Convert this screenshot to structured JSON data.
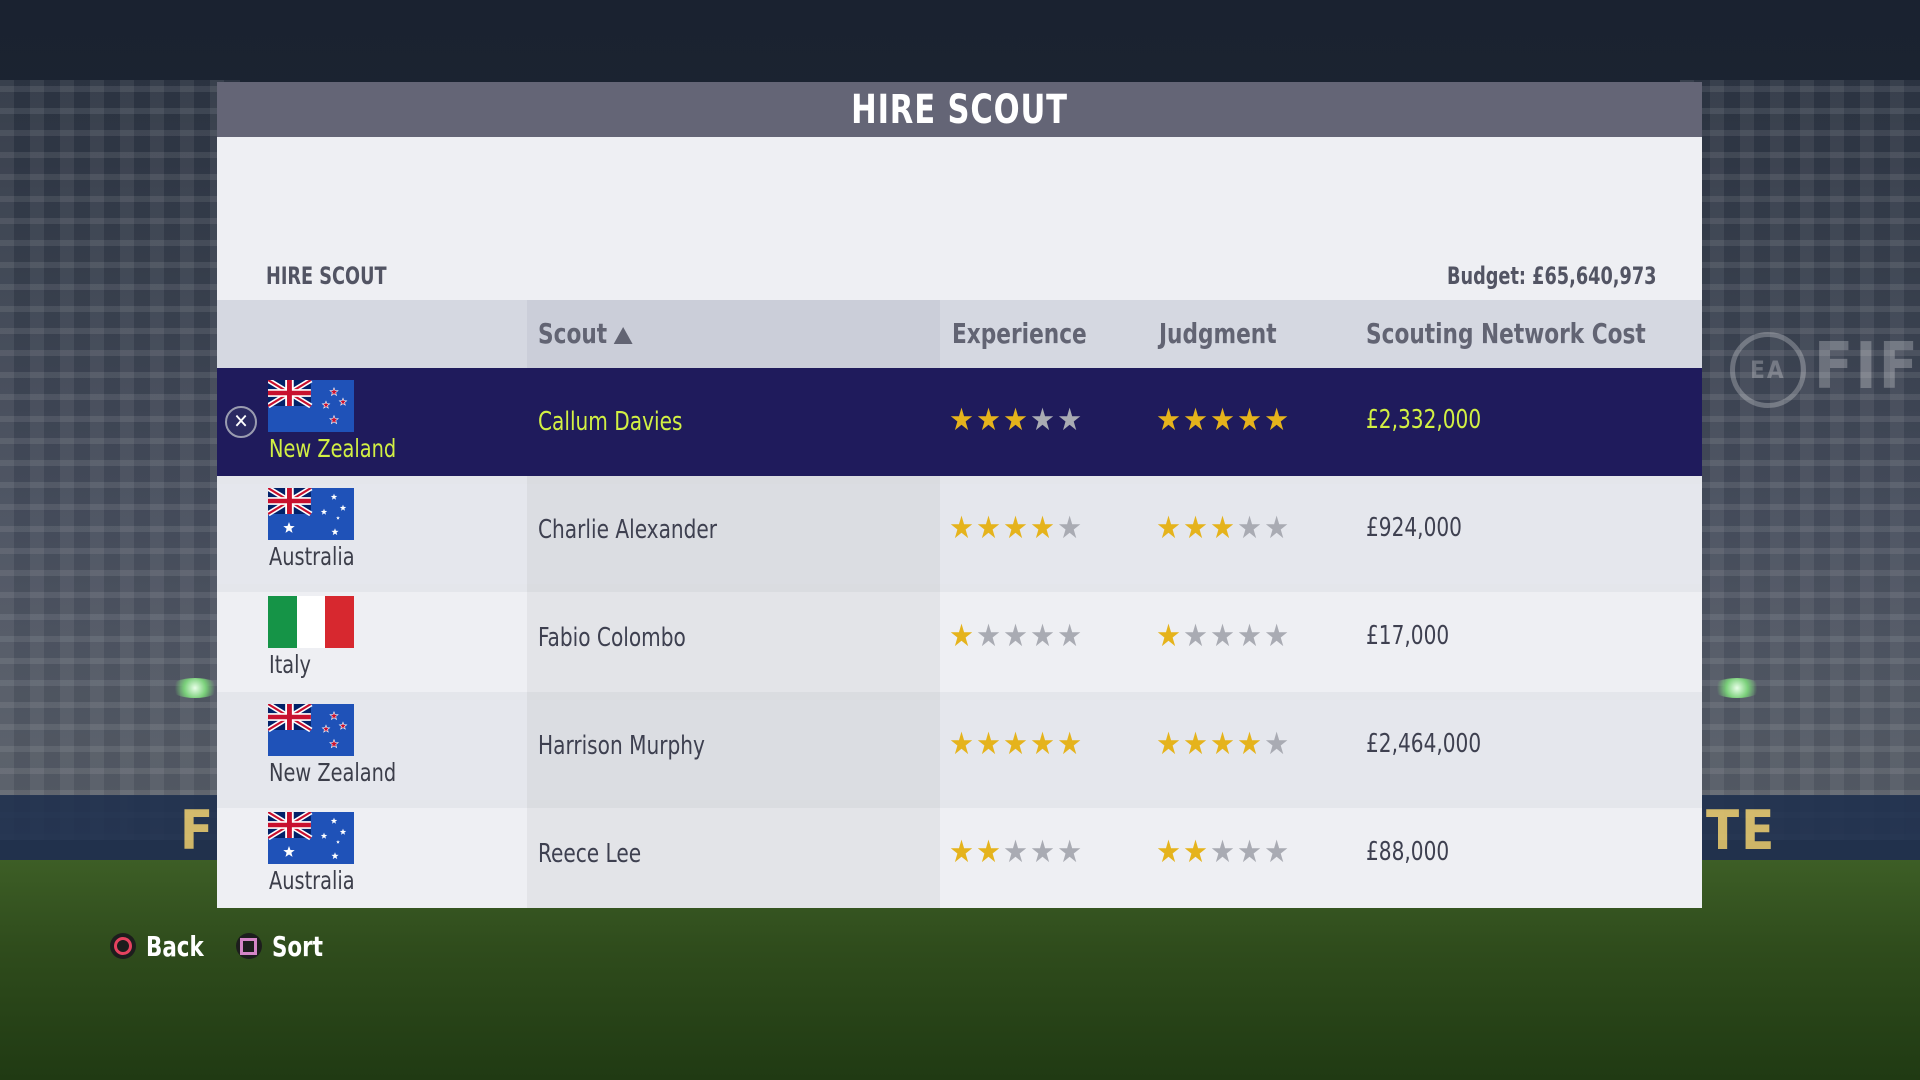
{
  "window": {
    "title": "HIRE SCOUT"
  },
  "section": {
    "title": "HIRE SCOUT",
    "budget": "Budget: £65,640,973"
  },
  "table": {
    "columns": {
      "scout": "Scout",
      "experience": "Experience",
      "judgment": "Judgment",
      "cost": "Scouting Network Cost"
    },
    "sort_column": "scout",
    "sort_direction": "ascending",
    "selected_index": 0,
    "rows": [
      {
        "flag_icon": "new-zealand-flag-icon",
        "country": "New Zealand",
        "name": "Callum Davies",
        "experience": 3,
        "judgment": 5,
        "cost": "£2,332,000"
      },
      {
        "flag_icon": "australia-flag-icon",
        "country": "Australia",
        "name": "Charlie Alexander",
        "experience": 4,
        "judgment": 3,
        "cost": "£924,000"
      },
      {
        "flag_icon": "italy-flag-icon",
        "country": "Italy",
        "name": "Fabio Colombo",
        "experience": 1,
        "judgment": 1,
        "cost": "£17,000"
      },
      {
        "flag_icon": "new-zealand-flag-icon",
        "country": "New Zealand",
        "name": "Harrison Murphy",
        "experience": 5,
        "judgment": 4,
        "cost": "£2,464,000"
      },
      {
        "flag_icon": "australia-flag-icon",
        "country": "Australia",
        "name": "Reece Lee",
        "experience": 2,
        "judgment": 2,
        "cost": "£88,000"
      }
    ],
    "max_stars": 5
  },
  "footer": {
    "back_label": "Back",
    "back_icon": "circle-button-icon",
    "sort_label": "Sort",
    "sort_icon": "square-button-icon"
  },
  "background": {
    "banner_left": "FI",
    "banner_right": "TE TEAM",
    "logo_text": "FIF",
    "logo_circle": "EA"
  },
  "colors": {
    "header_bg": "#646576",
    "selected_row_bg": "#1f1b5c",
    "selected_text": "#d2f043",
    "star_on": "#e5b31c",
    "star_off": "#a9abb3"
  }
}
